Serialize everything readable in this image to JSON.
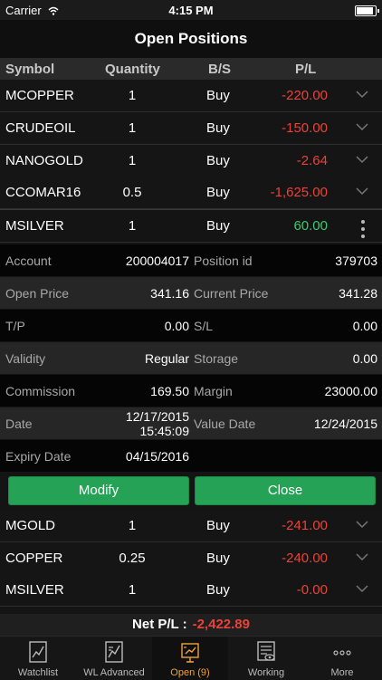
{
  "status": {
    "carrier": "Carrier",
    "time": "4:15 PM"
  },
  "title": "Open Positions",
  "headers": {
    "symbol": "Symbol",
    "quantity": "Quantity",
    "bs": "B/S",
    "pl": "P/L"
  },
  "rows": [
    {
      "symbol": "MCOPPER",
      "qty": "1",
      "bs": "Buy",
      "pl": "-220.00"
    },
    {
      "symbol": "CRUDEOIL",
      "qty": "1",
      "bs": "Buy",
      "pl": "-150.00"
    },
    {
      "symbol": "NANOGOLD",
      "qty": "1",
      "bs": "Buy",
      "pl": "-2.64"
    },
    {
      "symbol": "CCOMAR16",
      "qty": "0.5",
      "bs": "Buy",
      "pl": "-1,625.00"
    },
    {
      "symbol": "MSILVER",
      "qty": "1",
      "bs": "Buy",
      "pl": "60.00"
    },
    {
      "symbol": "MGOLD",
      "qty": "1",
      "bs": "Buy",
      "pl": "-241.00"
    },
    {
      "symbol": "COPPER",
      "qty": "0.25",
      "bs": "Buy",
      "pl": "-240.00"
    },
    {
      "symbol": "MSILVER",
      "qty": "1",
      "bs": "Buy",
      "pl": "-0.00"
    }
  ],
  "details": {
    "account_label": "Account",
    "account": "200004017",
    "position_id_label": "Position id",
    "position_id": "379703",
    "open_price_label": "Open Price",
    "open_price": "341.16",
    "current_price_label": "Current Price",
    "current_price": "341.28",
    "tp_label": "T/P",
    "tp": "0.00",
    "sl_label": "S/L",
    "sl": "0.00",
    "validity_label": "Validity",
    "validity": "Regular",
    "storage_label": "Storage",
    "storage": "0.00",
    "commission_label": "Commission",
    "commission": "169.50",
    "margin_label": "Margin",
    "margin": "23000.00",
    "date_label": "Date",
    "date_line1": "12/17/2015",
    "date_line2": "15:45:09",
    "value_date_label": "Value Date",
    "value_date": "12/24/2015",
    "expiry_date_label": "Expiry Date",
    "expiry_date": "04/15/2016"
  },
  "buttons": {
    "modify": "Modify",
    "close": "Close"
  },
  "net_pl": {
    "label": "Net P/L :",
    "value": "-2,422.89"
  },
  "tabs": [
    {
      "label": "Watchlist",
      "icon": "chart-icon"
    },
    {
      "label": "WL Advanced",
      "icon": "advanced-chart-icon"
    },
    {
      "label": "Open (9)",
      "icon": "open-positions-icon"
    },
    {
      "label": "Working",
      "icon": "working-orders-icon"
    },
    {
      "label": "More",
      "icon": "more-icon"
    }
  ],
  "colors": {
    "negative": "#e8433a",
    "positive": "#3ec872",
    "accent": "#f2a23a",
    "button": "#26a257"
  }
}
